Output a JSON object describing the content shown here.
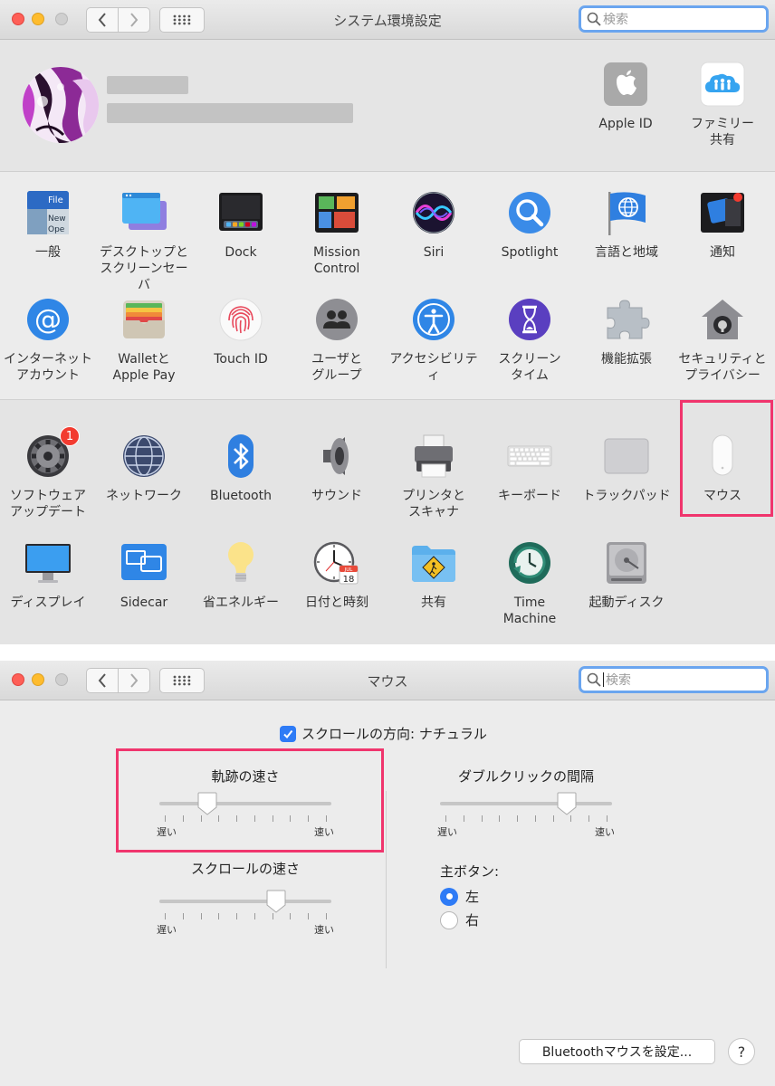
{
  "window1": {
    "title": "システム環境設定",
    "search_placeholder": "検索"
  },
  "profile": {
    "apple_id_label": "Apple ID",
    "family_label": "ファミリー\n共有"
  },
  "panes_row1": [
    {
      "label": "一般",
      "icon": "general-icon"
    },
    {
      "label": "デスクトップと\nスクリーンセーバ",
      "icon": "desktop-icon"
    },
    {
      "label": "Dock",
      "icon": "dock-icon"
    },
    {
      "label": "Mission\nControl",
      "icon": "mission-control-icon"
    },
    {
      "label": "Siri",
      "icon": "siri-icon"
    },
    {
      "label": "Spotlight",
      "icon": "spotlight-icon"
    },
    {
      "label": "言語と地域",
      "icon": "globe-flag-icon"
    },
    {
      "label": "通知",
      "icon": "notifications-icon"
    }
  ],
  "panes_row2": [
    {
      "label": "インターネット\nアカウント",
      "icon": "at-icon"
    },
    {
      "label": "Walletと\nApple Pay",
      "icon": "wallet-icon"
    },
    {
      "label": "Touch ID",
      "icon": "fingerprint-icon"
    },
    {
      "label": "ユーザと\nグループ",
      "icon": "users-icon"
    },
    {
      "label": "アクセシビリティ",
      "icon": "accessibility-icon"
    },
    {
      "label": "スクリーン\nタイム",
      "icon": "hourglass-icon"
    },
    {
      "label": "機能拡張",
      "icon": "puzzle-icon"
    },
    {
      "label": "セキュリティと\nプライバシー",
      "icon": "house-lock-icon"
    }
  ],
  "panes_row3": [
    {
      "label": "ソフトウェア\nアップデート",
      "icon": "gear-icon",
      "badge": "1"
    },
    {
      "label": "ネットワーク",
      "icon": "network-globe-icon"
    },
    {
      "label": "Bluetooth",
      "icon": "bluetooth-icon"
    },
    {
      "label": "サウンド",
      "icon": "speaker-icon"
    },
    {
      "label": "プリンタと\nスキャナ",
      "icon": "printer-icon"
    },
    {
      "label": "キーボード",
      "icon": "keyboard-icon"
    },
    {
      "label": "トラックパッド",
      "icon": "trackpad-icon"
    },
    {
      "label": "マウス",
      "icon": "mouse-icon"
    }
  ],
  "panes_row4": [
    {
      "label": "ディスプレイ",
      "icon": "display-icon"
    },
    {
      "label": "Sidecar",
      "icon": "sidecar-icon"
    },
    {
      "label": "省エネルギー",
      "icon": "lightbulb-icon"
    },
    {
      "label": "日付と時刻",
      "icon": "clock-calendar-icon",
      "calendar_month": "JUL",
      "calendar_day": "18"
    },
    {
      "label": "共有",
      "icon": "sharing-folder-icon"
    },
    {
      "label": "Time\nMachine",
      "icon": "time-machine-icon"
    },
    {
      "label": "起動ディスク",
      "icon": "disk-icon"
    }
  ],
  "window2": {
    "title": "マウス",
    "search_placeholder": "検索"
  },
  "mouse": {
    "natural_scroll_label": "スクロールの方向: ナチュラル",
    "natural_scroll_checked": true,
    "tracking": {
      "title": "軌跡の速さ",
      "low": "遅い",
      "high": "速い",
      "value": 0.25
    },
    "scrolling": {
      "title": "スクロールの速さ",
      "low": "遅い",
      "high": "速い",
      "value": 0.7
    },
    "double_click": {
      "title": "ダブルクリックの間隔",
      "low": "遅い",
      "high": "速い",
      "value": 0.77
    },
    "primary_button": {
      "title": "主ボタン:",
      "options": [
        {
          "label": "左",
          "selected": true
        },
        {
          "label": "右",
          "selected": false
        }
      ]
    },
    "bluetooth_button": "Bluetoothマウスを設定...",
    "help_button": "?"
  },
  "colors": {
    "highlight": "#f0356d",
    "accent": "#2e7bf6"
  }
}
